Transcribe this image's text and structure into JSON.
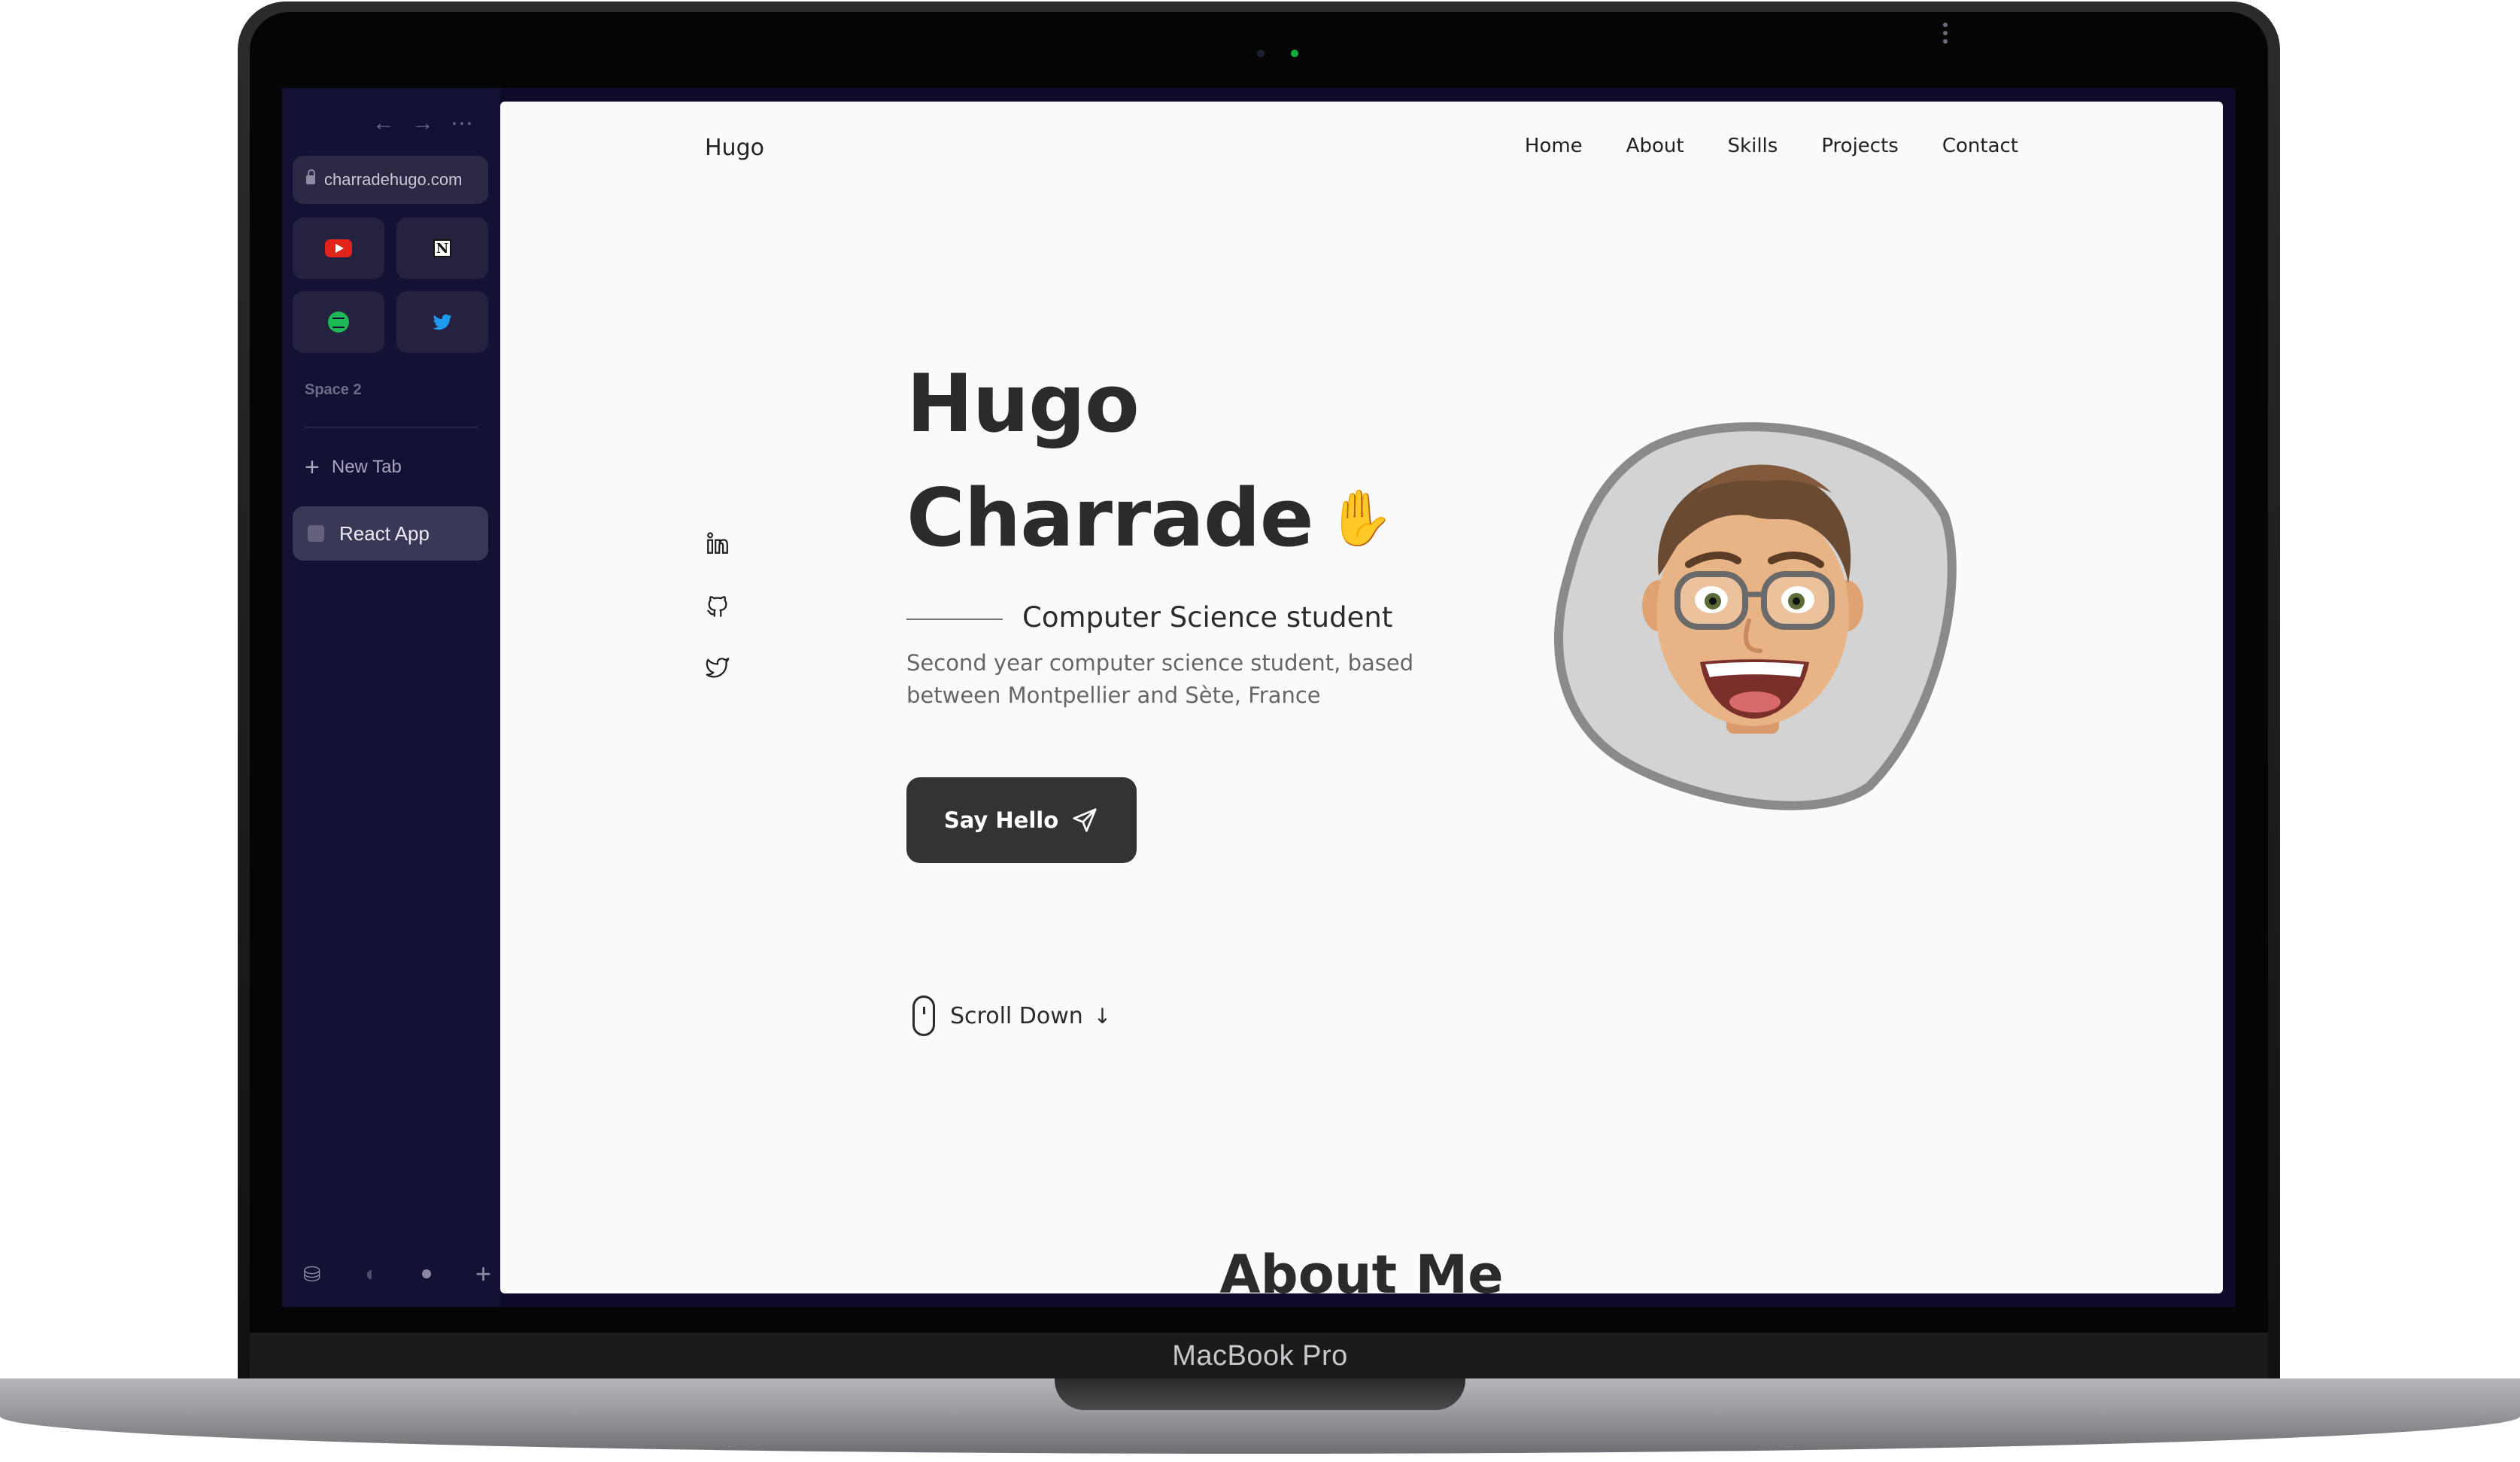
{
  "device": {
    "label": "MacBook Pro"
  },
  "browser": {
    "url": "charradehugo.com",
    "space_label": "Space 2",
    "new_tab_label": "New Tab",
    "active_tab_label": "React App",
    "favorites": [
      "youtube-icon",
      "notion-icon",
      "spotify-icon",
      "twitter-icon"
    ]
  },
  "site": {
    "logo": "Hugo",
    "nav": [
      "Home",
      "About",
      "Skills",
      "Projects",
      "Contact"
    ],
    "hero": {
      "first_name": "Hugo",
      "last_name": "Charrade",
      "wave": "✋",
      "subtitle": "Computer Science student",
      "description": "Second year computer science student, based between Montpellier and Sète, France",
      "cta_label": "Say Hello",
      "scroll_label": "Scroll Down",
      "scroll_arrow": "↓"
    },
    "social": [
      "linkedin-icon",
      "github-icon",
      "twitter-icon"
    ],
    "next_section_title": "About Me"
  },
  "colors": {
    "sidebar_bg": "#141234",
    "page_bg": "#fafafa",
    "text": "#2b2b2b",
    "button_bg": "#333333",
    "avatar_blob": "#d3d3d3"
  }
}
